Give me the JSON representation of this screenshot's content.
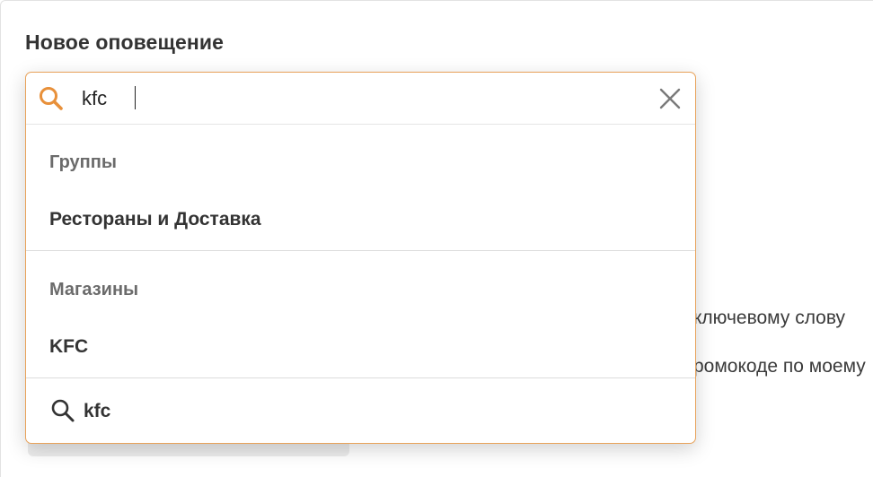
{
  "page": {
    "title": "Новое оповещение"
  },
  "background": {
    "line1": "ключевому слову",
    "line2": "ромокоде по моему"
  },
  "search": {
    "value": "kfc",
    "accent_color": "#e8903a"
  },
  "dropdown": {
    "groups_header": "Группы",
    "groups_items": [
      "Рестораны и Доставка"
    ],
    "shops_header": "Магазины",
    "shops_items": [
      "KFC"
    ],
    "search_suggestion": "kfc"
  }
}
